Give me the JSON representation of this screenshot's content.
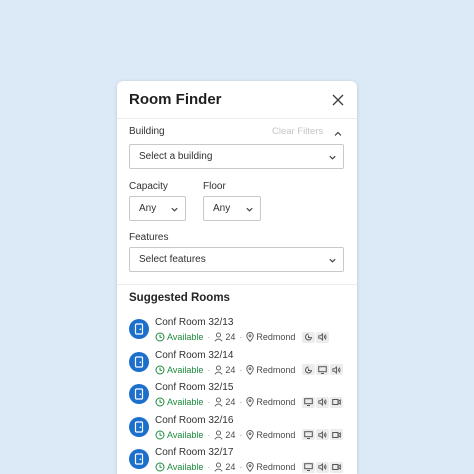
{
  "panel": {
    "title": "Room Finder",
    "building_label": "Building",
    "clear_filters": "Clear Filters",
    "building_select": "Select a building",
    "capacity_label": "Capacity",
    "capacity_value": "Any",
    "floor_label": "Floor",
    "floor_value": "Any",
    "features_label": "Features",
    "features_select": "Select features",
    "suggested_title": "Suggested Rooms"
  },
  "rooms": [
    {
      "name": "Conf Room 32/13",
      "status": "Available",
      "capacity": "24",
      "location": "Redmond",
      "features": [
        "accessibility-icon",
        "audio-icon"
      ]
    },
    {
      "name": "Conf Room 32/14",
      "status": "Available",
      "capacity": "24",
      "location": "Redmond",
      "features": [
        "accessibility-icon",
        "display-icon",
        "audio-icon"
      ]
    },
    {
      "name": "Conf Room 32/15",
      "status": "Available",
      "capacity": "24",
      "location": "Redmond",
      "features": [
        "display-icon",
        "audio-icon",
        "video-icon"
      ]
    },
    {
      "name": "Conf Room 32/16",
      "status": "Available",
      "capacity": "24",
      "location": "Redmond",
      "features": [
        "display-icon",
        "audio-icon",
        "video-icon"
      ]
    },
    {
      "name": "Conf Room 32/17",
      "status": "Available",
      "capacity": "24",
      "location": "Redmond",
      "features": [
        "display-icon",
        "audio-icon",
        "video-icon"
      ]
    }
  ],
  "colors": {
    "background": "#dce9f7",
    "accent": "#1c6fca",
    "available": "#1e8a3c"
  }
}
